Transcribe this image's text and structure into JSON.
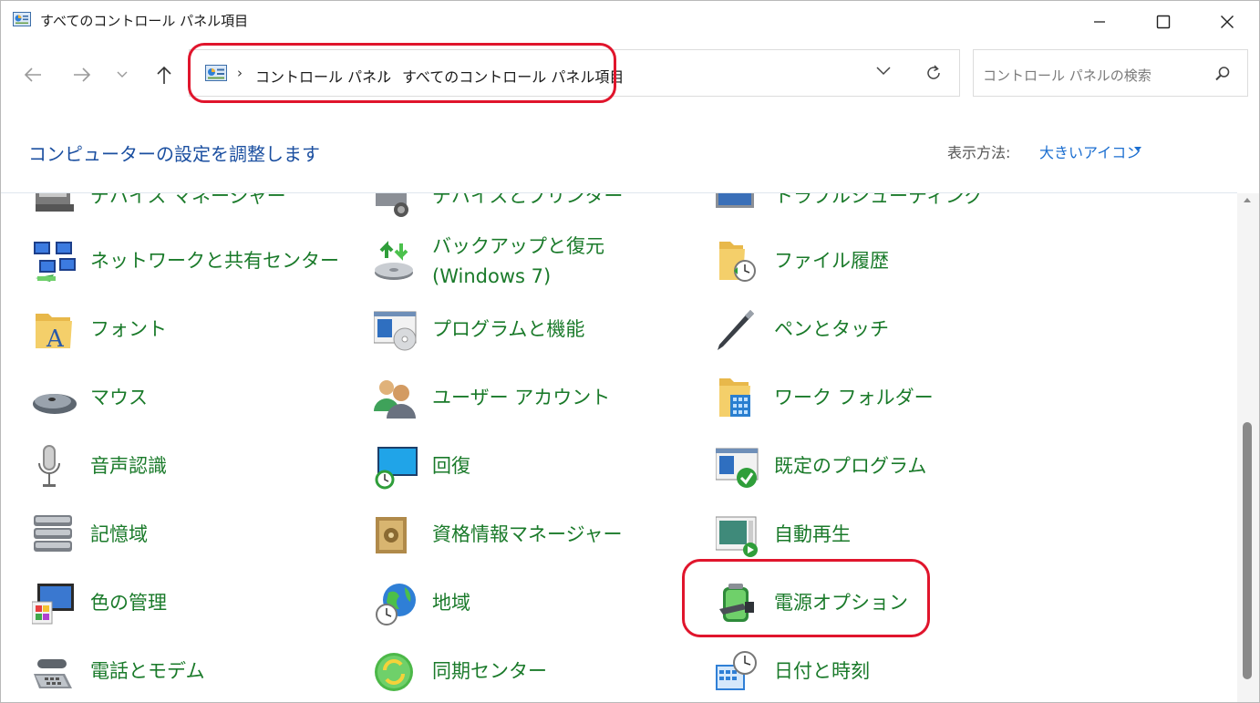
{
  "window": {
    "title": "すべてのコントロール パネル項目",
    "icon": "control-panel-icon"
  },
  "address": {
    "crumbs": [
      "コントロール パネル",
      "すべてのコントロール パネル項目"
    ],
    "search_placeholder": "コントロール パネルの検索"
  },
  "header": {
    "title": "コンピューターの設定を調整します",
    "view_label": "表示方法:",
    "view_value": "大きいアイコン"
  },
  "items": {
    "col1": [
      {
        "label": "デバイス マネージャー",
        "icon": "device-manager-icon"
      },
      {
        "label": "ネットワークと共有センター",
        "icon": "network-icon"
      },
      {
        "label": "フォント",
        "icon": "fonts-icon"
      },
      {
        "label": "マウス",
        "icon": "mouse-icon"
      },
      {
        "label": "音声認識",
        "icon": "microphone-icon"
      },
      {
        "label": "記憶域",
        "icon": "storage-icon"
      },
      {
        "label": "色の管理",
        "icon": "color-management-icon"
      },
      {
        "label": "電話とモデム",
        "icon": "phone-icon"
      }
    ],
    "col2": [
      {
        "label": "デバイスとプリンター",
        "icon": "printer-icon"
      },
      {
        "label": "バックアップと復元",
        "label2": "(Windows 7)",
        "icon": "backup-icon"
      },
      {
        "label": "プログラムと機能",
        "icon": "programs-icon"
      },
      {
        "label": "ユーザー アカウント",
        "icon": "users-icon"
      },
      {
        "label": "回復",
        "icon": "recovery-icon"
      },
      {
        "label": "資格情報マネージャー",
        "icon": "vault-icon"
      },
      {
        "label": "地域",
        "icon": "globe-icon"
      },
      {
        "label": "同期センター",
        "icon": "sync-icon"
      }
    ],
    "col3": [
      {
        "label": "トラブルシューティング",
        "icon": "troubleshoot-icon"
      },
      {
        "label": "ファイル履歴",
        "icon": "file-history-icon"
      },
      {
        "label": "ペンとタッチ",
        "icon": "pen-icon"
      },
      {
        "label": "ワーク フォルダー",
        "icon": "work-folders-icon"
      },
      {
        "label": "既定のプログラム",
        "icon": "default-programs-icon"
      },
      {
        "label": "自動再生",
        "icon": "autoplay-icon"
      },
      {
        "label": "電源オプション",
        "icon": "power-icon"
      },
      {
        "label": "日付と時刻",
        "icon": "datetime-icon"
      }
    ]
  }
}
